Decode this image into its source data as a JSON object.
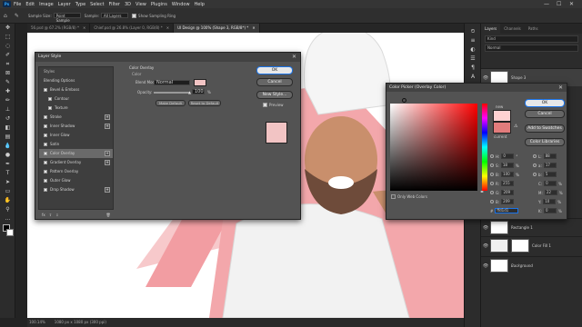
{
  "menubar": {
    "items": [
      "File",
      "Edit",
      "Image",
      "Layer",
      "Type",
      "Select",
      "Filter",
      "3D",
      "View",
      "Plugins",
      "Window",
      "Help"
    ],
    "window_controls": [
      "—",
      "☐",
      "✕"
    ]
  },
  "options_bar": {
    "sample_size_label": "Sample Size:",
    "sample_size_value": "Point Sample",
    "sample_label": "Sample:",
    "sample_value": "All Layers",
    "show_ring_label": "Show Sampling Ring"
  },
  "doc_tabs": [
    {
      "label": "56.psd @ 67.2% (RGB/8) *"
    },
    {
      "label": "Chief.psd @ 26.8% (Layer 0, RGB/8) *"
    },
    {
      "label": "UI Design @ 100% (Shape 3, RGB/8*) *"
    }
  ],
  "statusbar": {
    "zoom": "100.14%",
    "doc": "1080 px x 1080 px (300 ppi)"
  },
  "layers_panel": {
    "tabs": [
      "Layers",
      "Channels",
      "Paths"
    ],
    "kind": "Kind",
    "blend": "Normal",
    "layers": [
      {
        "name": "Shape 3"
      },
      {
        "name": "Rectangle 1"
      },
      {
        "name": "Color Fill 1"
      },
      {
        "name": "Background"
      }
    ]
  },
  "layer_style": {
    "title": "Layer Style",
    "styles_header": "Styles",
    "items": [
      {
        "label": "Blending Options",
        "checkbox": false,
        "plus": false,
        "indent": false
      },
      {
        "label": "Bevel & Emboss",
        "checkbox": true,
        "plus": false,
        "indent": false
      },
      {
        "label": "Contour",
        "checkbox": true,
        "plus": false,
        "indent": true
      },
      {
        "label": "Texture",
        "checkbox": true,
        "plus": false,
        "indent": true
      },
      {
        "label": "Stroke",
        "checkbox": true,
        "plus": true,
        "indent": false
      },
      {
        "label": "Inner Shadow",
        "checkbox": true,
        "plus": true,
        "indent": false
      },
      {
        "label": "Inner Glow",
        "checkbox": true,
        "plus": false,
        "indent": false
      },
      {
        "label": "Satin",
        "checkbox": true,
        "plus": false,
        "indent": false
      },
      {
        "label": "Color Overlay",
        "checkbox": true,
        "plus": true,
        "indent": false,
        "active": true
      },
      {
        "label": "Gradient Overlay",
        "checkbox": true,
        "plus": true,
        "indent": false
      },
      {
        "label": "Pattern Overlay",
        "checkbox": true,
        "plus": false,
        "indent": false
      },
      {
        "label": "Outer Glow",
        "checkbox": true,
        "plus": false,
        "indent": false
      },
      {
        "label": "Drop Shadow",
        "checkbox": true,
        "plus": true,
        "indent": false
      }
    ],
    "bottom": {
      "fx": "fx",
      "up": "⇧",
      "down": "⇩",
      "trash": "🗑"
    },
    "section_title": "Color Overlay",
    "section_sub": "Color",
    "blend_mode_label": "Blend Mode:",
    "blend_mode_value": "Normal",
    "opacity_label": "Opacity:",
    "opacity_value": "100",
    "opacity_unit": "%",
    "opacity_level": 1.0,
    "overlay_color": "#f2c4c4",
    "make_default": "Make Default",
    "reset_default": "Reset to Default",
    "ok": "OK",
    "cancel": "Cancel",
    "new_style": "New Style...",
    "preview": "Preview"
  },
  "color_picker": {
    "title": "Color Picker (Overlay Color)",
    "new_label": "new",
    "current_label": "current",
    "new_color": "#ffd1d1",
    "current_color": "#e27c7c",
    "ok": "OK",
    "cancel": "Cancel",
    "add_to_swatches": "Add to Swatches",
    "color_libraries": "Color Libraries",
    "only_web_colors": "Only Web Colors",
    "fields": [
      {
        "label": "H:",
        "value": "0",
        "unit": "°"
      },
      {
        "label": "S:",
        "value": "18",
        "unit": "%"
      },
      {
        "label": "B:",
        "value": "100",
        "unit": "%"
      },
      {
        "label": "R:",
        "value": "255",
        "unit": ""
      },
      {
        "label": "G:",
        "value": "209",
        "unit": ""
      },
      {
        "label": "B:",
        "value": "209",
        "unit": ""
      }
    ],
    "lab_fields": [
      {
        "label": "L:",
        "value": "88",
        "unit": ""
      },
      {
        "label": "a:",
        "value": "17",
        "unit": ""
      },
      {
        "label": "b:",
        "value": "5",
        "unit": ""
      },
      {
        "label": "C:",
        "value": "0",
        "unit": "%"
      },
      {
        "label": "M:",
        "value": "22",
        "unit": "%"
      },
      {
        "label": "Y:",
        "value": "10",
        "unit": "%"
      },
      {
        "label": "K:",
        "value": "0",
        "unit": "%"
      }
    ],
    "hex_label": "#",
    "hex_value": "ffd1d1"
  },
  "colors": {
    "accent": "#31a8ff",
    "pink_shape": "#f7b6b8"
  }
}
